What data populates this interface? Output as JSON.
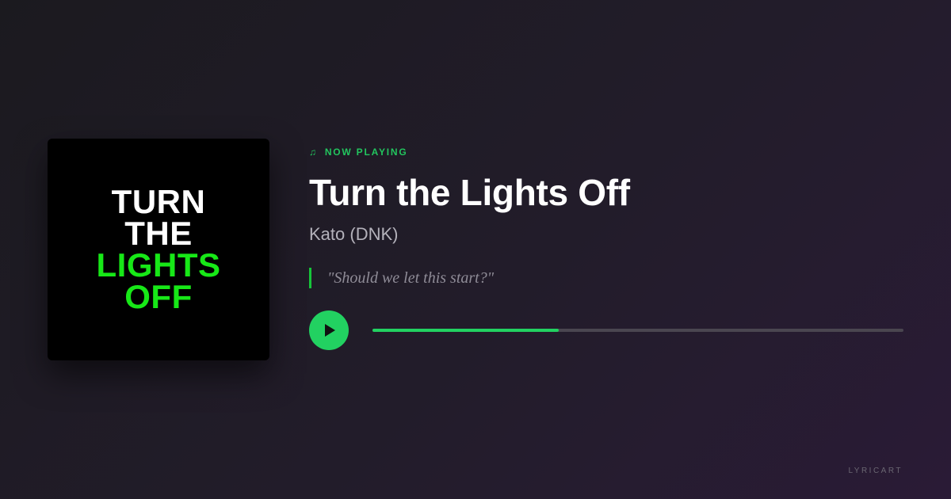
{
  "album_art": {
    "lines": [
      {
        "text": "TURN",
        "color": "#ffffff"
      },
      {
        "text": "THE",
        "color": "#ffffff"
      },
      {
        "text": "LIGHTS",
        "color": "#17e817"
      },
      {
        "text": "OFF",
        "color": "#17e817"
      }
    ],
    "background": "#000000"
  },
  "now_playing": {
    "icon": "music-note-icon",
    "label": "NOW PLAYING"
  },
  "track": {
    "title": "Turn the Lights Off",
    "artist": "Kato (DNK)",
    "lyric": "\"Should we let this start?\""
  },
  "player": {
    "play_icon": "play-icon",
    "progress": 0.35
  },
  "brand": "LYRICART",
  "colors": {
    "accent": "#22d161",
    "art_green": "#17e817",
    "quote_bar": "#16c53a",
    "track": "#4a4650"
  }
}
